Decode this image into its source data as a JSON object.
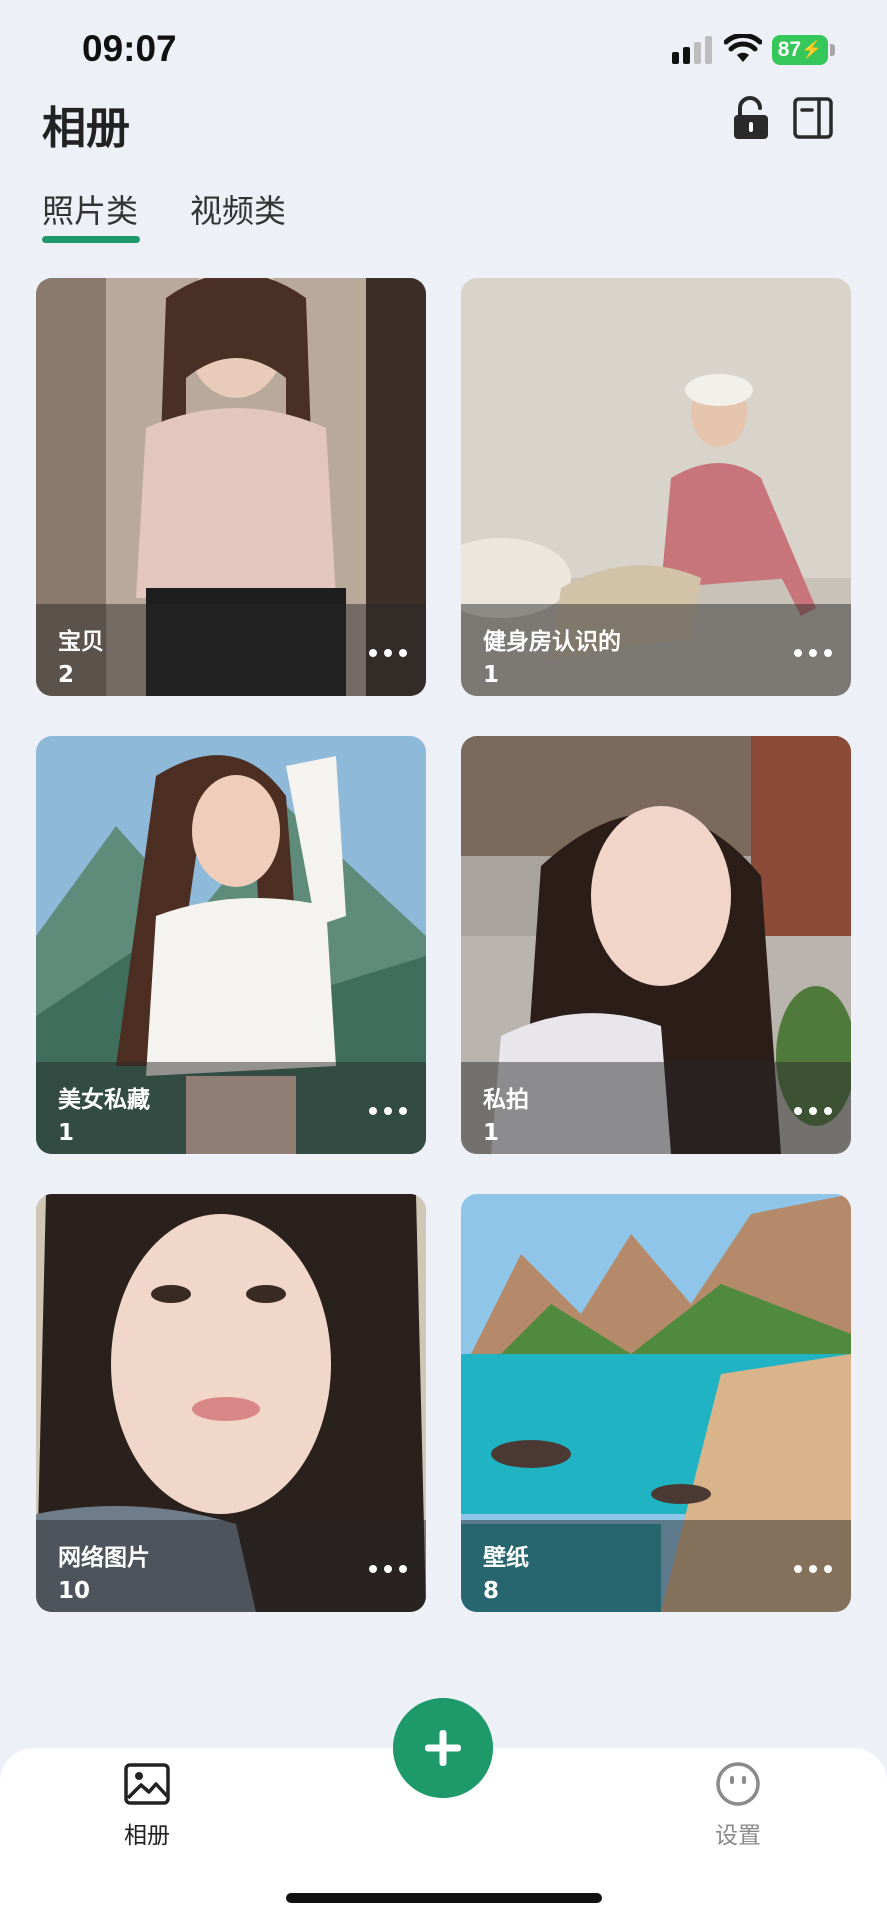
{
  "status_bar": {
    "time": "09:07",
    "battery": "87",
    "icons": [
      "signal-icon",
      "wifi-icon",
      "battery-icon"
    ]
  },
  "header": {
    "title": "相册",
    "actions": [
      "lock-open-icon",
      "book-icon"
    ]
  },
  "tabs": [
    {
      "label": "照片类",
      "active": true
    },
    {
      "label": "视频类",
      "active": false
    }
  ],
  "albums": [
    {
      "name": "宝贝",
      "count": "2"
    },
    {
      "name": "健身房认识的",
      "count": "1"
    },
    {
      "name": "美女私藏",
      "count": "1"
    },
    {
      "name": "私拍",
      "count": "1"
    },
    {
      "name": "网络图片",
      "count": "10"
    },
    {
      "name": "壁纸",
      "count": "8"
    }
  ],
  "bottom_nav": {
    "items": [
      {
        "label": "相册",
        "icon": "image-icon",
        "active": true
      },
      {
        "label": "设置",
        "icon": "face-icon",
        "active": false
      }
    ],
    "fab_icon": "plus-icon"
  },
  "colors": {
    "accent": "#1e9a6a",
    "background": "#edf1f7",
    "battery": "#35c759"
  }
}
